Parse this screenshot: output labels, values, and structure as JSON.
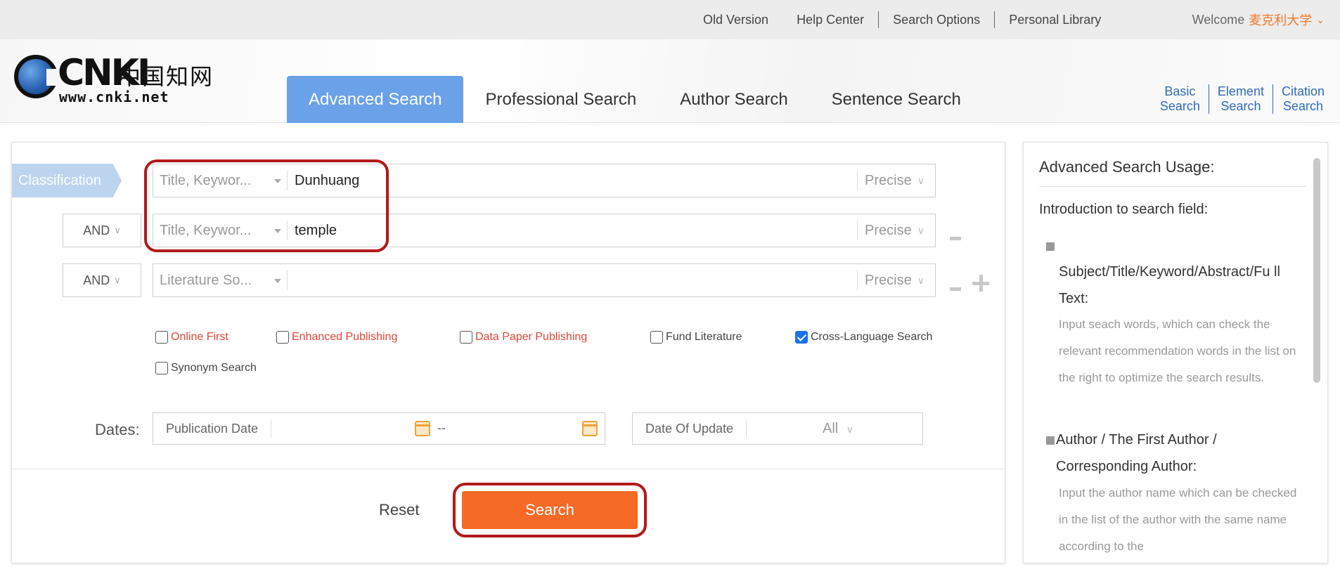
{
  "topbar": {
    "links": [
      "Old Version",
      "Help Center",
      "Search Options",
      "Personal Library"
    ],
    "welcome_label": "Welcome",
    "user_name": "麦克利大学"
  },
  "logo": {
    "brand": "CNKI",
    "chinese": "中国知网",
    "url": "www.cnki.net"
  },
  "tabs": [
    {
      "label": "Advanced Search",
      "active": true
    },
    {
      "label": "Professional Search",
      "active": false
    },
    {
      "label": "Author Search",
      "active": false
    },
    {
      "label": "Sentence Search",
      "active": false
    }
  ],
  "right_links": [
    {
      "line1": "Basic",
      "line2": "Search"
    },
    {
      "line1": "Element",
      "line2": "Search"
    },
    {
      "line1": "Citation",
      "line2": "Search"
    }
  ],
  "form": {
    "classification_label": "Classification",
    "rows": [
      {
        "logic": "",
        "field": "Title, Keywor...",
        "value": "Dunhuang",
        "match": "Precise"
      },
      {
        "logic": "AND",
        "field": "Title, Keywor...",
        "value": "temple",
        "match": "Precise"
      },
      {
        "logic": "AND",
        "field": "Literature So...",
        "value": "",
        "match": "Precise"
      }
    ],
    "options": [
      {
        "label": "Online First",
        "checked": false,
        "style": "red"
      },
      {
        "label": "Enhanced Publishing",
        "checked": false,
        "style": "red"
      },
      {
        "label": "Data Paper Publishing",
        "checked": false,
        "style": "red"
      },
      {
        "label": "Fund Literature",
        "checked": false,
        "style": "dark"
      },
      {
        "label": "Cross-Language Search",
        "checked": true,
        "style": "dark"
      },
      {
        "label": "Synonym Search",
        "checked": false,
        "style": "dark"
      }
    ],
    "dates_label": "Dates:",
    "publication_date_label": "Publication Date",
    "date_separator": "--",
    "update_label": "Date Of Update",
    "update_value": "All",
    "reset_label": "Reset",
    "search_label": "Search"
  },
  "usage": {
    "title": "Advanced Search Usage:",
    "intro": "Introduction to search field:",
    "sections": [
      {
        "heading": "Subject/Title/Keyword/Abstract/Fu ll Text:",
        "desc": "Input seach words, which can check the relevant recommendation words in the list on the right to optimize the search results."
      },
      {
        "heading": "Author / The First Author / Corresponding Author:",
        "desc": "Input the author name which can be checked in the list of the author with the same name according to the"
      }
    ]
  },
  "colors": {
    "active_tab": "#6aa1e8",
    "search_button": "#f56a26",
    "highlight_box": "#b11a1a",
    "link_blue": "#2e6bb8",
    "option_red": "#e0453a",
    "username": "#f07826"
  }
}
